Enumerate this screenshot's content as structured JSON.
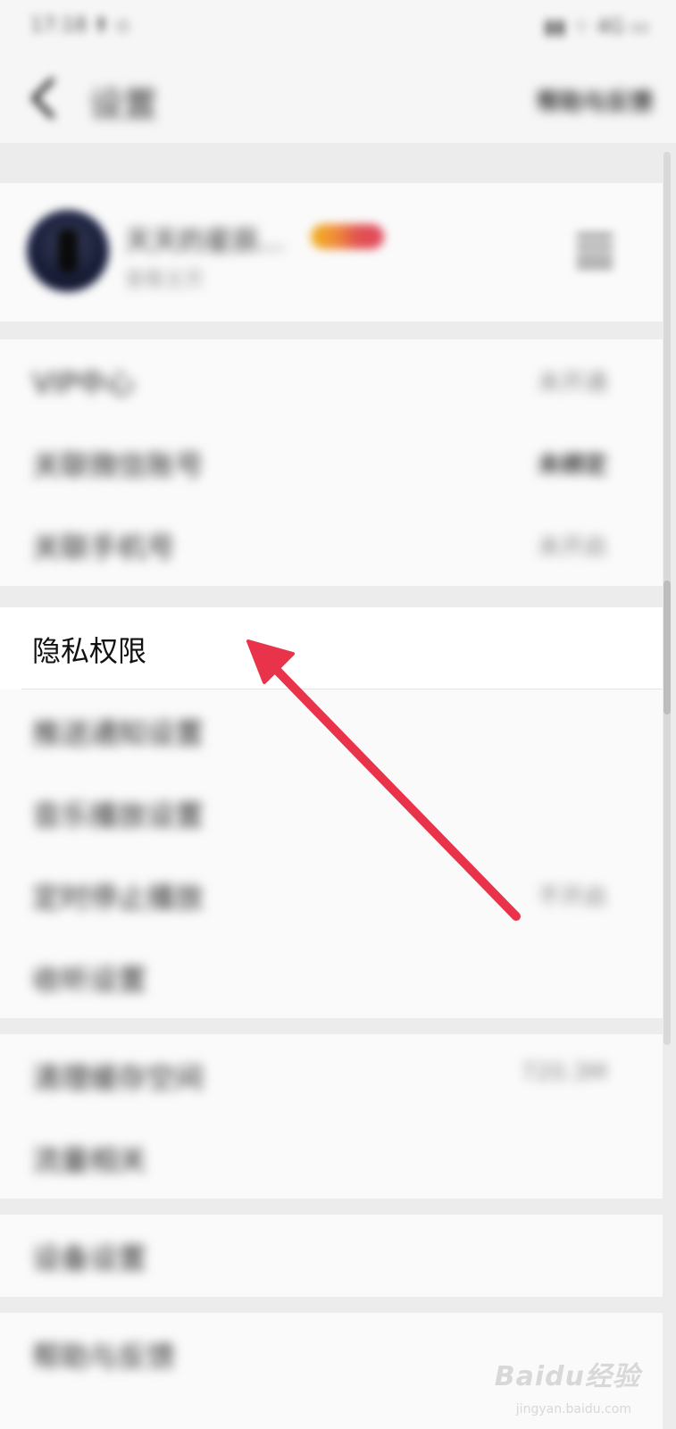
{
  "status_bar": {
    "left": "17:18 ⬆ ▫",
    "right": "▮▮ ⌔ 4G ▭"
  },
  "nav": {
    "back_icon": "chevron-left-icon",
    "title": "设置",
    "right": "帮助与反馈"
  },
  "profile": {
    "name": "天天的星辰...",
    "subtitle": "查看主页",
    "vip_colors": [
      "#f2b41c",
      "#e24a60"
    ],
    "qr_icon": "qr-code-icon"
  },
  "group1": [
    {
      "label": "VIP中心",
      "value": "未开通"
    },
    {
      "label": "关联微信账号",
      "value": "未绑定"
    },
    {
      "label": "关联手机号",
      "value": "未开启"
    }
  ],
  "privacy": {
    "label": "隐私权限"
  },
  "group2": [
    {
      "label": "推送通知设置",
      "value": ""
    },
    {
      "label": "音乐播放设置",
      "value": ""
    },
    {
      "label": "定时停止播放",
      "value": "不开启"
    },
    {
      "label": "收听设置",
      "value": ""
    }
  ],
  "group3": [
    {
      "label": "清理缓存空间",
      "value": "720.3M"
    },
    {
      "label": "流量相关",
      "value": ""
    }
  ],
  "group4": [
    {
      "label": "设备设置",
      "value": ""
    }
  ],
  "group5": [
    {
      "label": "帮助与反馈",
      "value": ""
    }
  ],
  "watermark": {
    "main": "Baidu经验",
    "sub": "jingyan.baidu.com"
  },
  "annotation": {
    "arrow_color": "#e8334a"
  }
}
